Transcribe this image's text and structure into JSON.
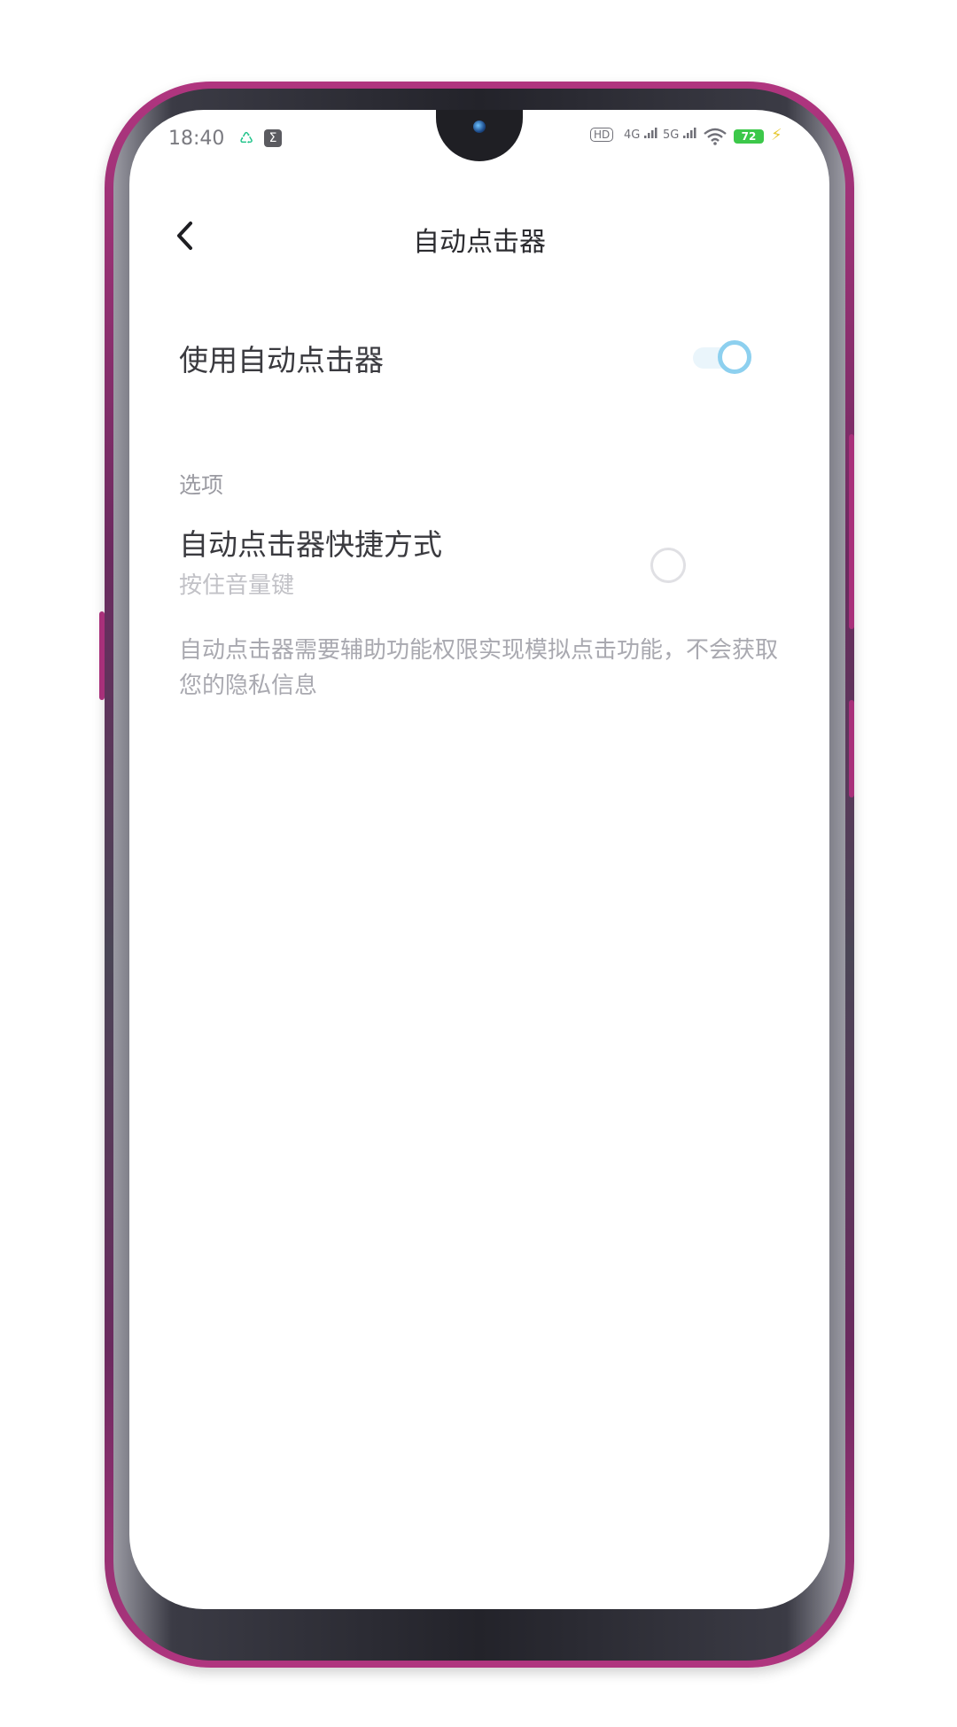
{
  "status_bar": {
    "time": "18:40",
    "app_icon_1": "♺",
    "app_icon_2": "Σ",
    "hd": "HD",
    "network_1": "4G",
    "network_2": "5G",
    "battery": "72"
  },
  "header": {
    "title": "自动点击器"
  },
  "main_setting": {
    "label": "使用自动点击器",
    "enabled": true
  },
  "options": {
    "section_title": "选项",
    "shortcut_title": "自动点击器快捷方式",
    "shortcut_subtitle": "按住音量键",
    "description": "自动点击器需要辅助功能权限实现模拟点击功能，不会获取您的隐私信息"
  },
  "colors": {
    "toggle_on": "#8dd0ef",
    "battery_green": "#3cc84a",
    "frame_accent": "#b0357f"
  }
}
